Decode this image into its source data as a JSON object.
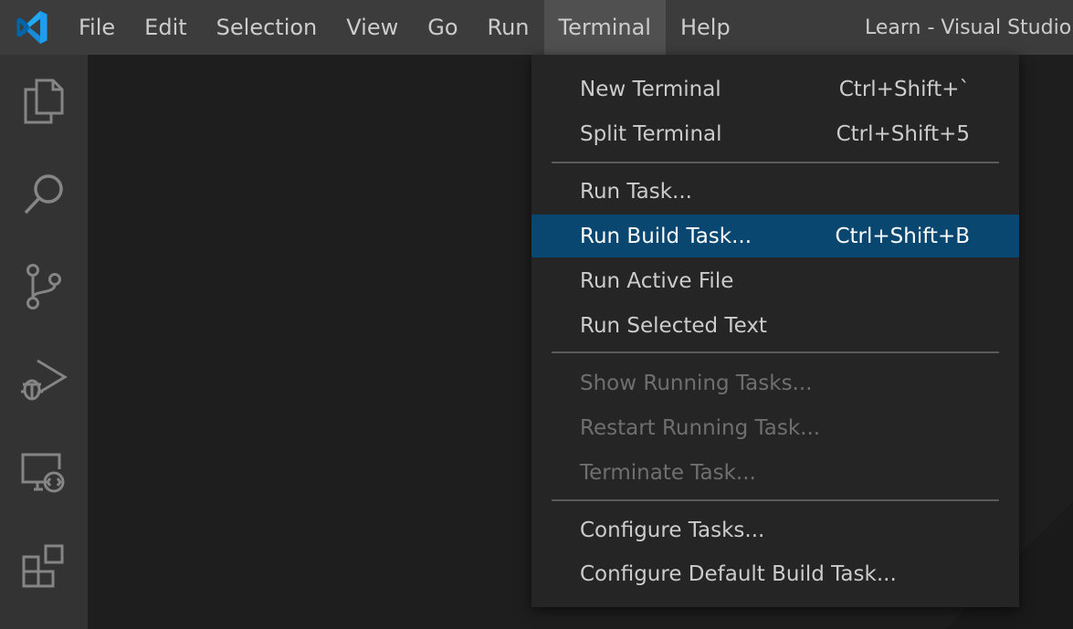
{
  "title_bar": {
    "window_title": "Learn - Visual Studio C",
    "menu": [
      {
        "label": "File"
      },
      {
        "label": "Edit"
      },
      {
        "label": "Selection"
      },
      {
        "label": "View"
      },
      {
        "label": "Go"
      },
      {
        "label": "Run"
      },
      {
        "label": "Terminal"
      },
      {
        "label": "Help"
      }
    ]
  },
  "activity_bar": {
    "icons": [
      "explorer-icon",
      "search-icon",
      "source-control-icon",
      "run-debug-icon",
      "remote-explorer-icon",
      "extensions-icon"
    ]
  },
  "terminal_menu": {
    "items": [
      {
        "label": "New Terminal",
        "shortcut": "Ctrl+Shift+`"
      },
      {
        "label": "Split Terminal",
        "shortcut": "Ctrl+Shift+5"
      },
      {
        "label": "Run Task..."
      },
      {
        "label": "Run Build Task...",
        "shortcut": "Ctrl+Shift+B"
      },
      {
        "label": "Run Active File"
      },
      {
        "label": "Run Selected Text"
      },
      {
        "label": "Show Running Tasks..."
      },
      {
        "label": "Restart Running Task..."
      },
      {
        "label": "Terminate Task..."
      },
      {
        "label": "Configure Tasks..."
      },
      {
        "label": "Configure Default Build Task..."
      }
    ]
  },
  "colors": {
    "titlebar": "#3c3c3c",
    "activitybar": "#333333",
    "editor": "#1e1e1e",
    "menu_bg": "#252526",
    "highlight": "#094771",
    "vscode_blue": "#23a9f2"
  }
}
